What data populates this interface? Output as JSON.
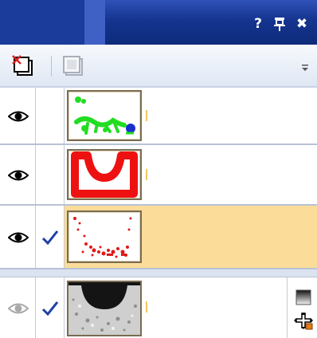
{
  "title_bar": {
    "title": "",
    "help_label": "?",
    "pin_label": "Т",
    "close_label": "✖"
  },
  "toolbar": {
    "buttons": [
      {
        "icon": "new-layer-icon",
        "enabled": true
      },
      {
        "icon": "duplicate-layer-icon",
        "enabled": false
      }
    ],
    "overflow_icon": "chevron-down-icon"
  },
  "layers": [
    {
      "visible": true,
      "checked": false,
      "selected": false,
      "thumbnail": "green-blue-scribble"
    },
    {
      "visible": true,
      "checked": false,
      "selected": false,
      "thumbnail": "red-u-shape"
    },
    {
      "visible": true,
      "checked": true,
      "selected": true,
      "thumbnail": "red-dots"
    },
    {
      "visible": false,
      "checked": true,
      "selected": false,
      "thumbnail": "grayscale-u-image",
      "side_icons": [
        "gradient-icon",
        "move-icon"
      ]
    }
  ],
  "colors": {
    "title_bar": "#14348f",
    "selected_row": "#fbdc99",
    "check": "#1e3fa6",
    "layer1_green": "#22dd22",
    "layer1_blue": "#1a2fd0",
    "layer2_red": "#ee1111",
    "layer3_red": "#e01818"
  }
}
